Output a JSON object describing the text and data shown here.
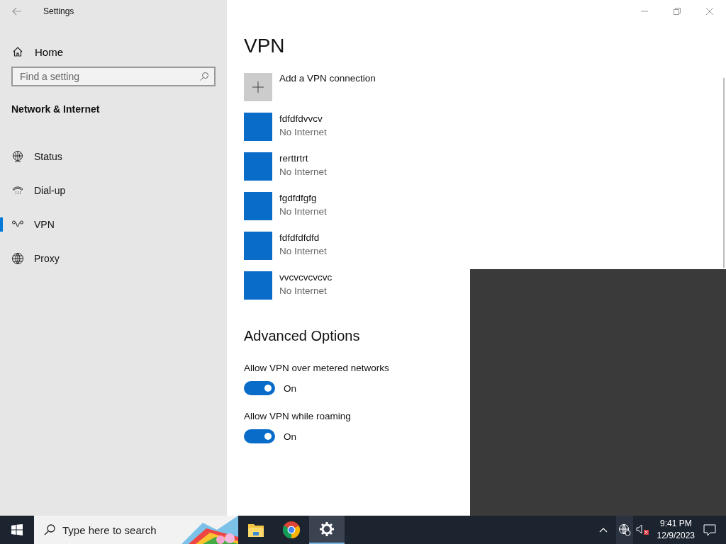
{
  "window": {
    "title": "Settings"
  },
  "sidebar": {
    "home": "Home",
    "search": {
      "placeholder": "Find a setting"
    },
    "section": "Network & Internet",
    "items": [
      {
        "label": "Status",
        "kind": "status",
        "selected": false
      },
      {
        "label": "Dial-up",
        "kind": "dialup",
        "selected": false
      },
      {
        "label": "VPN",
        "kind": "vpn",
        "selected": true
      },
      {
        "label": "Proxy",
        "kind": "proxy",
        "selected": false
      }
    ]
  },
  "page": {
    "title": "VPN",
    "add": "Add a VPN connection",
    "connections": [
      {
        "name": "fdfdfdvvcv",
        "status": "No Internet"
      },
      {
        "name": "rerttrtrt",
        "status": "No Internet"
      },
      {
        "name": "fgdfdfgfg",
        "status": "No Internet"
      },
      {
        "name": "fdfdfdfdfd",
        "status": "No Internet"
      },
      {
        "name": "vvcvcvcvcvc",
        "status": "No Internet"
      }
    ],
    "advanced_title": "Advanced Options",
    "options": [
      {
        "label": "Allow VPN over metered networks",
        "on": true,
        "state": "On"
      },
      {
        "label": "Allow VPN while roaming",
        "on": true,
        "state": "On"
      }
    ]
  },
  "taskbar": {
    "search": {
      "placeholder": "Type here to search"
    },
    "apps": [
      {
        "kind": "explorer",
        "selected": false
      },
      {
        "kind": "chrome",
        "selected": false
      },
      {
        "kind": "settings",
        "selected": true
      }
    ],
    "time": "9:41 PM",
    "date": "12/9/2023"
  }
}
